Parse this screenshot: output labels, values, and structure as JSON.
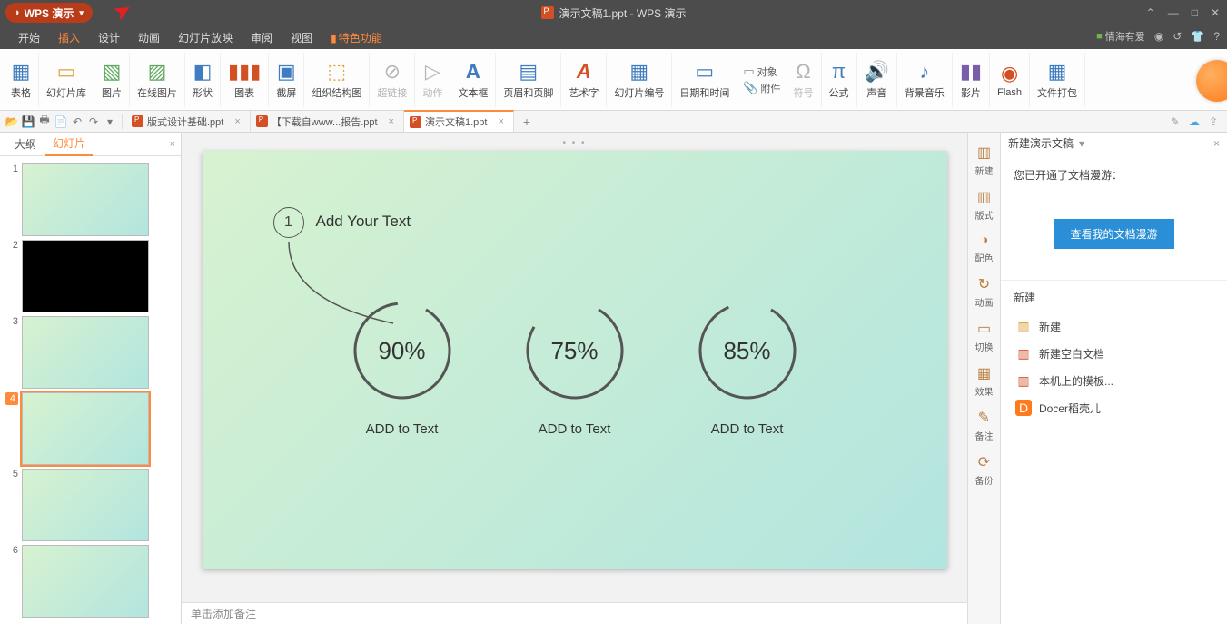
{
  "app": {
    "name": "WPS 演示",
    "title_doc": "演示文稿1.ppt - WPS 演示"
  },
  "menu": {
    "items": [
      "开始",
      "插入",
      "设计",
      "动画",
      "幻灯片放映",
      "审阅",
      "视图",
      "特色功能"
    ],
    "active_index": 1,
    "user_label": "情海有爱"
  },
  "ribbon": {
    "items": [
      {
        "label": "表格",
        "ico": "▦"
      },
      {
        "label": "幻灯片库",
        "ico": "▭"
      },
      {
        "label": "图片",
        "ico": "🖼"
      },
      {
        "label": "在线图片",
        "ico": "🖼"
      },
      {
        "label": "形状",
        "ico": "◧"
      },
      {
        "label": "图表",
        "ico": "📊"
      },
      {
        "label": "截屏",
        "ico": "▣"
      },
      {
        "label": "组织结构图",
        "ico": "⬚"
      },
      {
        "label": "超链接",
        "ico": "🔗",
        "disabled": true
      },
      {
        "label": "动作",
        "ico": "▶",
        "disabled": true
      },
      {
        "label": "文本框",
        "ico": "𝐀"
      },
      {
        "label": "页眉和页脚",
        "ico": "▤"
      },
      {
        "label": "艺术字",
        "ico": "A"
      },
      {
        "label": "幻灯片编号",
        "ico": "▦"
      },
      {
        "label": "日期和时间",
        "ico": "📅"
      }
    ],
    "pair": {
      "obj": "对象",
      "att": "附件"
    },
    "more": [
      {
        "label": "符号",
        "ico": "Ω",
        "disabled": true
      },
      {
        "label": "公式",
        "ico": "π"
      },
      {
        "label": "声音",
        "ico": "🔊"
      },
      {
        "label": "背景音乐",
        "ico": "♪"
      },
      {
        "label": "影片",
        "ico": "🎞"
      },
      {
        "label": "Flash",
        "ico": "⚡"
      },
      {
        "label": "文件打包",
        "ico": "▦"
      }
    ]
  },
  "tabs": {
    "items": [
      {
        "label": "版式设计基础.ppt"
      },
      {
        "label": "【下载自www...报告.ppt"
      },
      {
        "label": "演示文稿1.ppt",
        "active": true
      }
    ]
  },
  "slide_panel": {
    "outline": "大纲",
    "slides": "幻灯片",
    "count": 6,
    "selected": 4
  },
  "slide": {
    "num": "1",
    "title": "Add Your Text",
    "rings": [
      {
        "pct": 90,
        "label": "ADD to Text"
      },
      {
        "pct": 75,
        "label": "ADD to Text"
      },
      {
        "pct": 85,
        "label": "ADD to Text"
      }
    ]
  },
  "notes_placeholder": "单击添加备注",
  "side_icons": [
    {
      "label": "新建",
      "ic": "▥"
    },
    {
      "label": "版式",
      "ic": "▥"
    },
    {
      "label": "配色",
      "ic": "◑"
    },
    {
      "label": "动画",
      "ic": "↻"
    },
    {
      "label": "切换",
      "ic": "▭"
    },
    {
      "label": "效果",
      "ic": "▦"
    },
    {
      "label": "备注",
      "ic": "✎"
    },
    {
      "label": "备份",
      "ic": "⟳"
    }
  ],
  "right_pane": {
    "title": "新建演示文稿",
    "info": "您已开通了文档漫游：",
    "button": "查看我的文档漫游",
    "section_title": "新建",
    "items": [
      {
        "label": "新建",
        "color": "#d99a2b"
      },
      {
        "label": "新建空白文档",
        "color": "#d35025"
      },
      {
        "label": "本机上的模板...",
        "color": "#d35025"
      },
      {
        "label": "Docer稻壳儿",
        "color": "#ff7a1a"
      }
    ]
  },
  "chart_data": {
    "type": "pie",
    "note": "three radial progress rings on slide",
    "series": [
      {
        "name": "ADD to Text",
        "values": [
          90
        ]
      },
      {
        "name": "ADD to Text",
        "values": [
          75
        ]
      },
      {
        "name": "ADD to Text",
        "values": [
          85
        ]
      }
    ],
    "ylim": [
      0,
      100
    ]
  }
}
